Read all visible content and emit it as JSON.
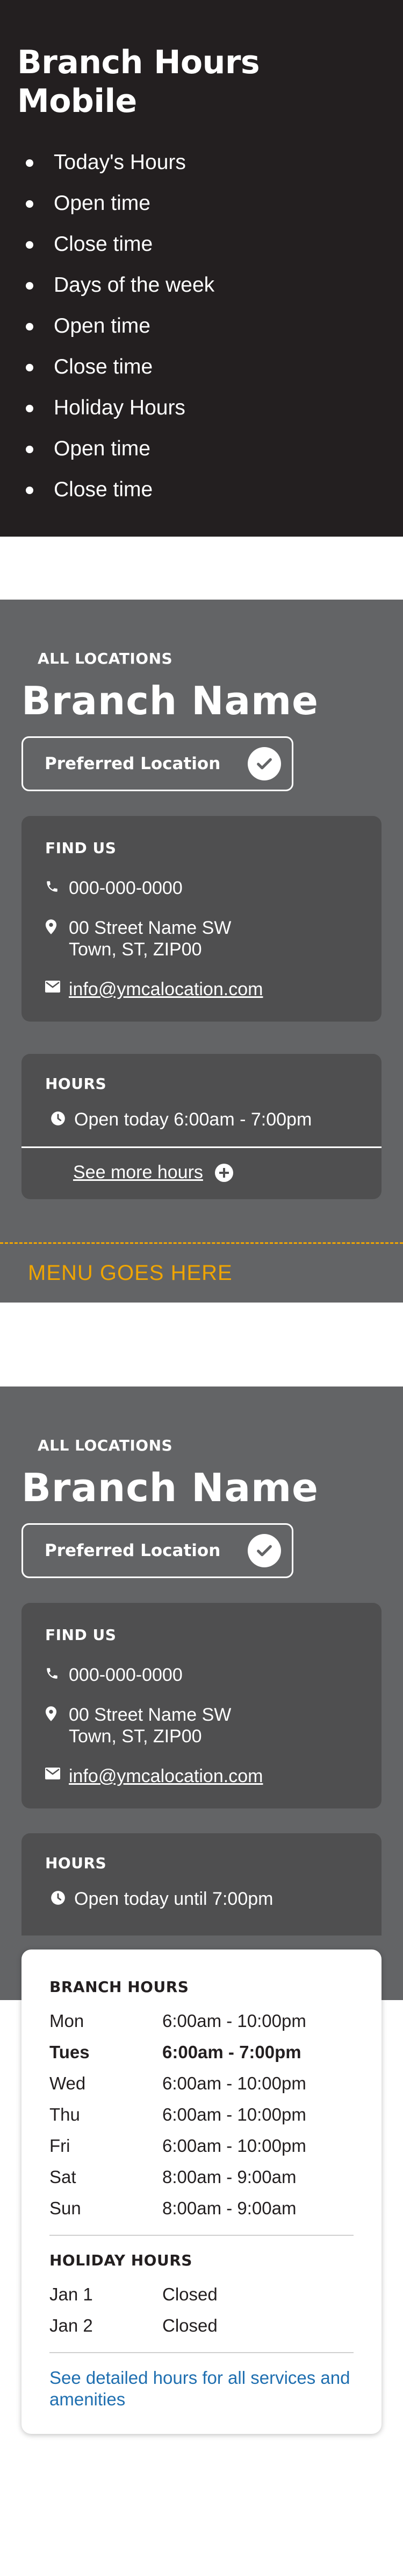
{
  "notes": {
    "title": "Branch Hours Mobile",
    "items": [
      "Today's Hours",
      "Open time",
      "Close time",
      "Days of the week",
      "Open time",
      "Close time",
      "Holiday Hours",
      "Open time",
      "Close time"
    ]
  },
  "panel1": {
    "all_locations": "ALL LOCATIONS",
    "branch_name": "Branch Name",
    "preferred": "Preferred Location",
    "find_us": "FIND US",
    "phone": "000-000-0000",
    "address_line1": "00 Street Name SW",
    "address_line2": "Town, ST, ZIP00",
    "email": "info@ymcalocation.com",
    "hours_title": "HOURS",
    "hours_status": "Open today 6:00am - 7:00pm",
    "see_more": "See more hours",
    "menu": "MENU GOES HERE"
  },
  "panel2": {
    "all_locations": "ALL LOCATIONS",
    "branch_name": "Branch Name",
    "preferred": "Preferred Location",
    "find_us": "FIND US",
    "phone": "000-000-0000",
    "address_line1": "00 Street Name SW",
    "address_line2": "Town, ST, ZIP00",
    "email": "info@ymcalocation.com",
    "hours_title": "HOURS",
    "hours_status": "Open today until 7:00pm",
    "branch_hours_title": "BRANCH HOURS",
    "branch_hours": [
      {
        "day": "Mon",
        "time": "6:00am - 10:00pm"
      },
      {
        "day": "Tues",
        "time": "6:00am - 7:00pm"
      },
      {
        "day": "Wed",
        "time": "6:00am - 10:00pm"
      },
      {
        "day": "Thu",
        "time": "6:00am - 10:00pm"
      },
      {
        "day": "Fri",
        "time": "6:00am - 10:00pm"
      },
      {
        "day": "Sat",
        "time": "8:00am - 9:00am"
      },
      {
        "day": "Sun",
        "time": "8:00am - 9:00am"
      }
    ],
    "holiday_title": "HOLIDAY HOURS",
    "holiday_hours": [
      {
        "day": "Jan 1",
        "time": "Closed"
      },
      {
        "day": "Jan 2",
        "time": "Closed"
      }
    ],
    "detail_link": "See detailed hours for all services and amenities"
  },
  "colors": {
    "notes_bg": "#231f20",
    "panel_bg": "#636466",
    "card_bg": "#4f4f50",
    "menu_accent": "#f0a500",
    "link": "#1f6fb0"
  },
  "icons": [
    "check-icon",
    "phone-icon",
    "map-pin-icon",
    "mail-icon",
    "clock-icon",
    "plus-circle-icon"
  ]
}
